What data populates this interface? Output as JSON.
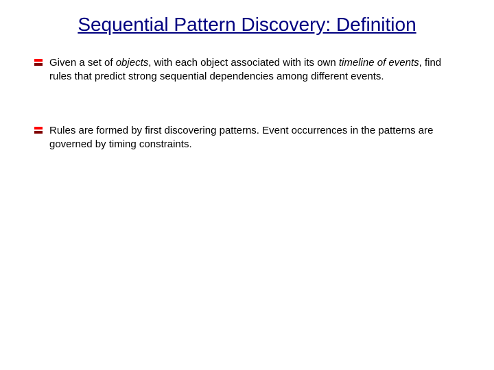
{
  "title": "Sequential Pattern Discovery: Definition",
  "bullets": [
    {
      "pre1": "Given  a set of ",
      "italic1": "objects",
      "mid1": ", with each object associated with its own ",
      "italic2": "timeline of events",
      "post1": ", find rules that predict strong sequential dependencies among different events."
    },
    {
      "text": "Rules are formed by first discovering patterns. Event occurrences in the patterns are governed by timing constraints."
    }
  ]
}
